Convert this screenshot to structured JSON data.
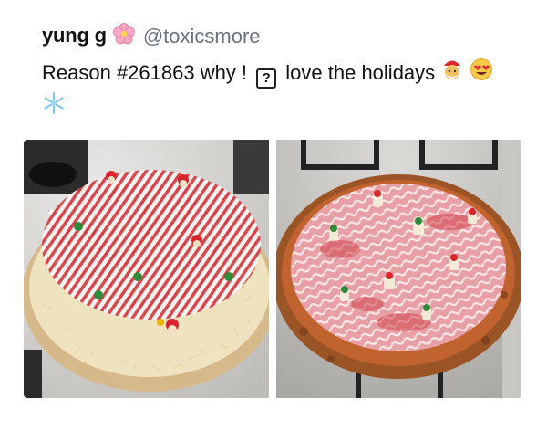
{
  "tweet": {
    "display_name": "yung g",
    "display_name_emoji": "cherry-blossom-icon",
    "handle": "@toxicsmore",
    "text_part1": "Reason #261863 why ! ",
    "unknown_glyph": "?",
    "text_part2": " love the holidays",
    "trailing_emoji": [
      "santa-face-icon",
      "heart-eyes-icon",
      "snowflake-icon"
    ]
  },
  "media": [
    {
      "name": "raw-candy-cane-pizza-photo",
      "alt_description": ""
    },
    {
      "name": "baked-candy-cane-pizza-photo",
      "alt_description": ""
    }
  ],
  "colors": {
    "text": "#111111",
    "handle": "#68737c"
  }
}
